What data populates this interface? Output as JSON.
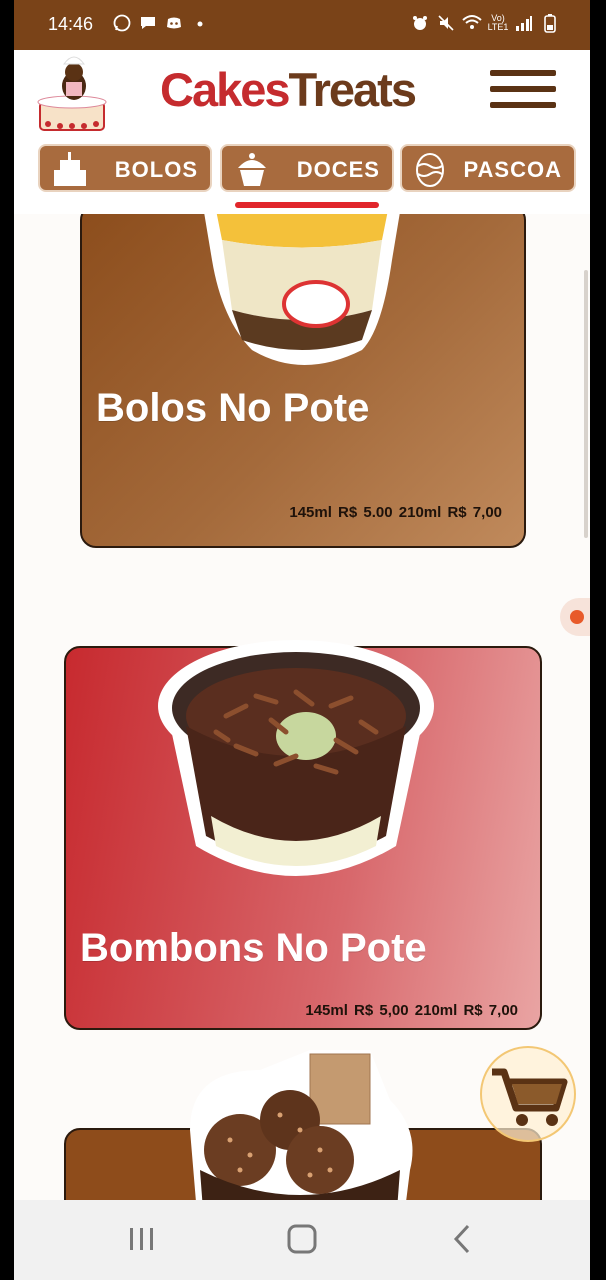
{
  "status_bar": {
    "time": "14:46",
    "lte_label": "Vo) LTE1",
    "icons": [
      "whatsapp-icon",
      "message-icon",
      "discord-icon",
      "dot-icon",
      "alarm-icon",
      "mute-icon",
      "wifi-icon",
      "signal-icon",
      "battery-icon"
    ]
  },
  "header": {
    "brand_part1": "Cakes",
    "brand_part2": "Treats",
    "brand_colors": {
      "cakes": "#c52b2e",
      "treats": "#6c3b1c"
    }
  },
  "tabs": [
    {
      "label": "BOLOS",
      "icon": "cake-icon",
      "selected": false
    },
    {
      "label": "DOCES",
      "icon": "cupcake-icon",
      "selected": true
    },
    {
      "label": "PASCOA",
      "icon": "easter-egg-icon",
      "selected": false
    }
  ],
  "products": [
    {
      "title": "Bolos No Pote",
      "prices": "145ml R$ 5.00   210ml R$ 7,00"
    },
    {
      "title": "Bombons No Pote",
      "prices": "145ml R$ 5,00   210ml R$ 7,00"
    },
    {
      "title": "",
      "prices": ""
    }
  ],
  "colors": {
    "accent_red": "#e1262b",
    "status_bar": "#7a4318",
    "tab_bg": "#a86b3e"
  }
}
